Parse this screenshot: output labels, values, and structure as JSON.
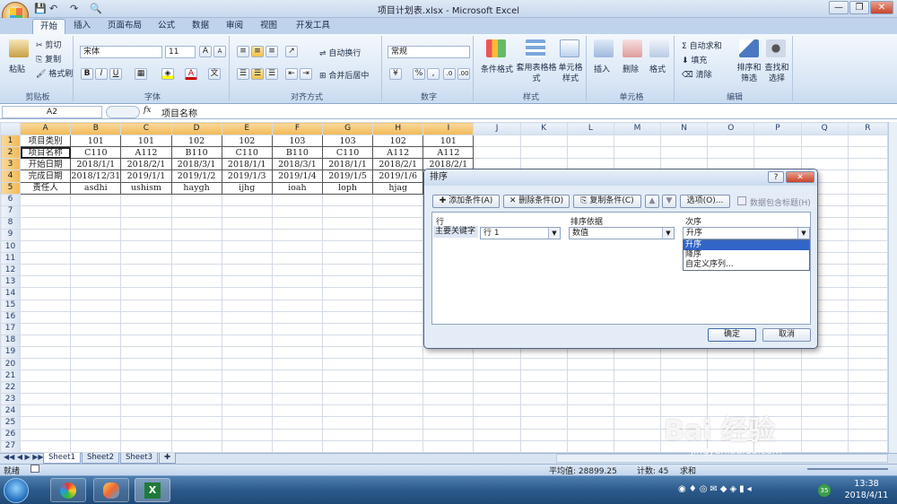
{
  "window": {
    "title": "项目计划表.xlsx - Microsoft Excel"
  },
  "window_controls": {
    "minimize": "—",
    "restore": "❐",
    "close": "✕"
  },
  "tabs": [
    "开始",
    "插入",
    "页面布局",
    "公式",
    "数据",
    "审阅",
    "视图",
    "开发工具"
  ],
  "ribbon": {
    "clipboard": {
      "paste": "粘贴",
      "cut": "剪切",
      "copy": "复制",
      "format_painter": "格式刷",
      "label": "剪贴板"
    },
    "font": {
      "name": "宋体",
      "size": "11",
      "label": "字体",
      "bold": "B",
      "italic": "I",
      "underline": "U",
      "grow": "A",
      "shrink": "A"
    },
    "alignment": {
      "wrap": "自动换行",
      "merge": "合并后居中",
      "label": "对齐方式"
    },
    "number": {
      "format": "常规",
      "percent": "%",
      "comma": ",",
      "label": "数字"
    },
    "styles": {
      "conditional": "条件格式",
      "table": "套用表格格式",
      "cell": "单元格样式",
      "label": "样式"
    },
    "cells": {
      "insert": "插入",
      "delete": "删除",
      "format": "格式",
      "label": "单元格"
    },
    "editing": {
      "autosum": "自动求和",
      "fill": "填充",
      "clear": "清除",
      "sort": "排序和筛选",
      "find": "查找和选择",
      "label": "编辑"
    }
  },
  "formula_bar": {
    "name_box": "A2",
    "fx": "fx",
    "content": "项目名称"
  },
  "grid": {
    "columns": [
      "",
      "A",
      "B",
      "C",
      "D",
      "E",
      "F",
      "G",
      "H",
      "I",
      "J",
      "K",
      "L",
      "M",
      "N",
      "O",
      "P",
      "Q",
      "R"
    ],
    "selected_columns": [
      "A",
      "B",
      "C",
      "D",
      "E",
      "F",
      "G",
      "H",
      "I"
    ],
    "row_numbers": [
      "1",
      "2",
      "3",
      "4",
      "5",
      "6",
      "7",
      "8",
      "9",
      "10",
      "11",
      "12",
      "13",
      "14",
      "15",
      "16",
      "17",
      "18",
      "19",
      "20",
      "21",
      "22",
      "23",
      "24",
      "25",
      "26",
      "27"
    ],
    "selected_rows": [
      "1",
      "2",
      "3",
      "4",
      "5"
    ],
    "rows": [
      [
        "项目类别",
        "101",
        "101",
        "102",
        "102",
        "103",
        "103",
        "102",
        "101"
      ],
      [
        "项目名称",
        "C110",
        "A112",
        "B110",
        "C110",
        "B110",
        "C110",
        "A112",
        "A112"
      ],
      [
        "开始日期",
        "2018/1/1",
        "2018/2/1",
        "2018/3/1",
        "2018/1/1",
        "2018/3/1",
        "2018/1/1",
        "2018/2/1",
        "2018/2/1"
      ],
      [
        "完成日期",
        "2018/12/31",
        "2019/1/1",
        "2019/1/2",
        "2019/1/3",
        "2019/1/4",
        "2019/1/5",
        "2019/1/6",
        ""
      ],
      [
        "责任人",
        "asdhi",
        "ushism",
        "haygh",
        "ijhg",
        "ioah",
        "loph",
        "hjag",
        ""
      ]
    ]
  },
  "sheets": [
    "Sheet1",
    "Sheet2",
    "Sheet3"
  ],
  "status": {
    "ready": "就绪",
    "average": "平均值: 28899.25",
    "count": "计数: 45",
    "sum": "求和"
  },
  "taskbar": {
    "time": "13:38",
    "date": "2018/4/11"
  },
  "dialog": {
    "title": "排序",
    "help": "?",
    "close": "✕",
    "add_condition": "添加条件(A)",
    "delete_condition": "删除条件(D)",
    "copy_condition": "复制条件(C)",
    "up": "▲",
    "down": "▼",
    "options": "选项(O)...",
    "header_checkbox": "数据包含标题(H)",
    "col_row": "行",
    "col_basis": "排序依据",
    "col_order": "次序",
    "primary_key": "主要关键字",
    "row_value": "行 1",
    "basis_value": "数值",
    "order_value": "升序",
    "order_options": [
      "升序",
      "降序",
      "自定义序列..."
    ],
    "ok": "确定",
    "cancel": "取消"
  },
  "watermark": {
    "text": "Bai 经验",
    "url": "jingyan.baidu.com"
  }
}
